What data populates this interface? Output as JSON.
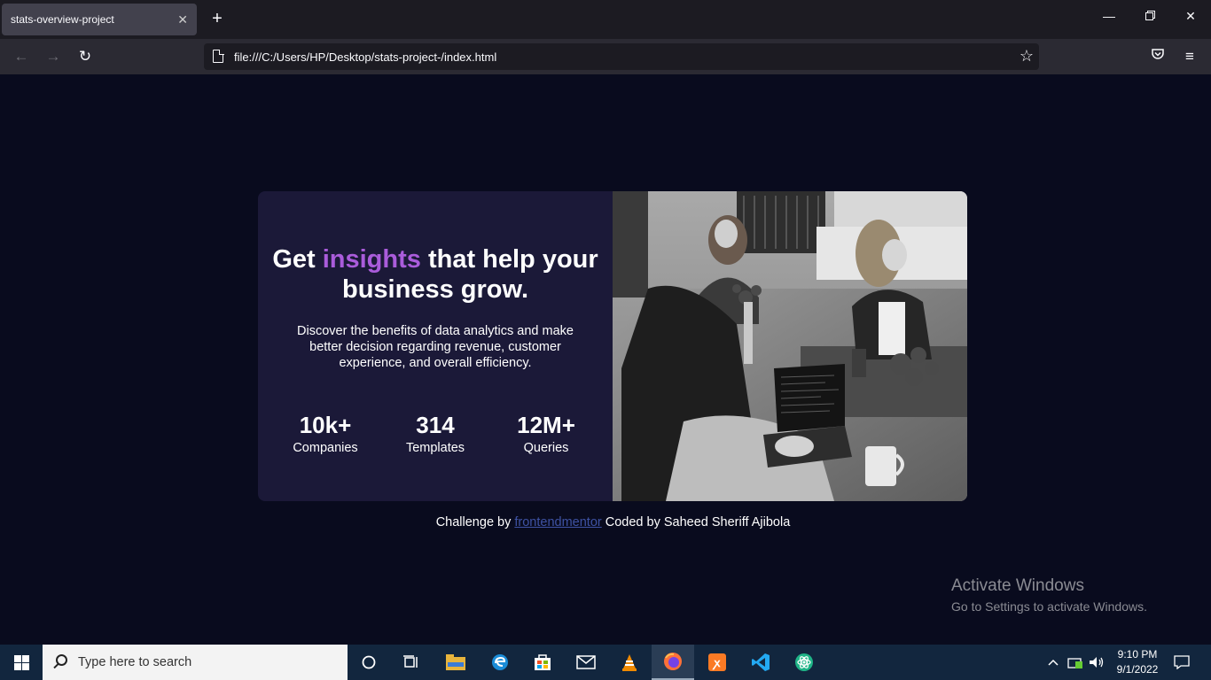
{
  "browser": {
    "tab_title": "stats-overview-project",
    "tab_close": "✕",
    "new_tab": "+",
    "url": "file:///C:/Users/HP/Desktop/stats-project-/index.html"
  },
  "card": {
    "headline_part1": "Get ",
    "headline_accent": "insights",
    "headline_part2": " that help your business grow.",
    "description": "Discover the benefits of data analytics and make better decision regarding revenue, customer experience, and overall efficiency.",
    "stats": [
      {
        "value": "10k+",
        "label": "Companies"
      },
      {
        "value": "314",
        "label": "Templates"
      },
      {
        "value": "12M+",
        "label": "Queries"
      }
    ]
  },
  "attribution": {
    "prefix": "Challenge by ",
    "link": "frontendmentor",
    "suffix": " Coded by Saheed Sheriff Ajibola"
  },
  "watermark": {
    "line1": "Activate Windows",
    "line2": "Go to Settings to activate Windows."
  },
  "taskbar": {
    "search_placeholder": "Type here to search",
    "time": "9:10 PM",
    "date": "9/1/2022"
  },
  "colors": {
    "page_bg": "#090b1e",
    "card_bg": "#1b1938",
    "accent": "#aa5cdb",
    "link": "#3e52a3"
  }
}
